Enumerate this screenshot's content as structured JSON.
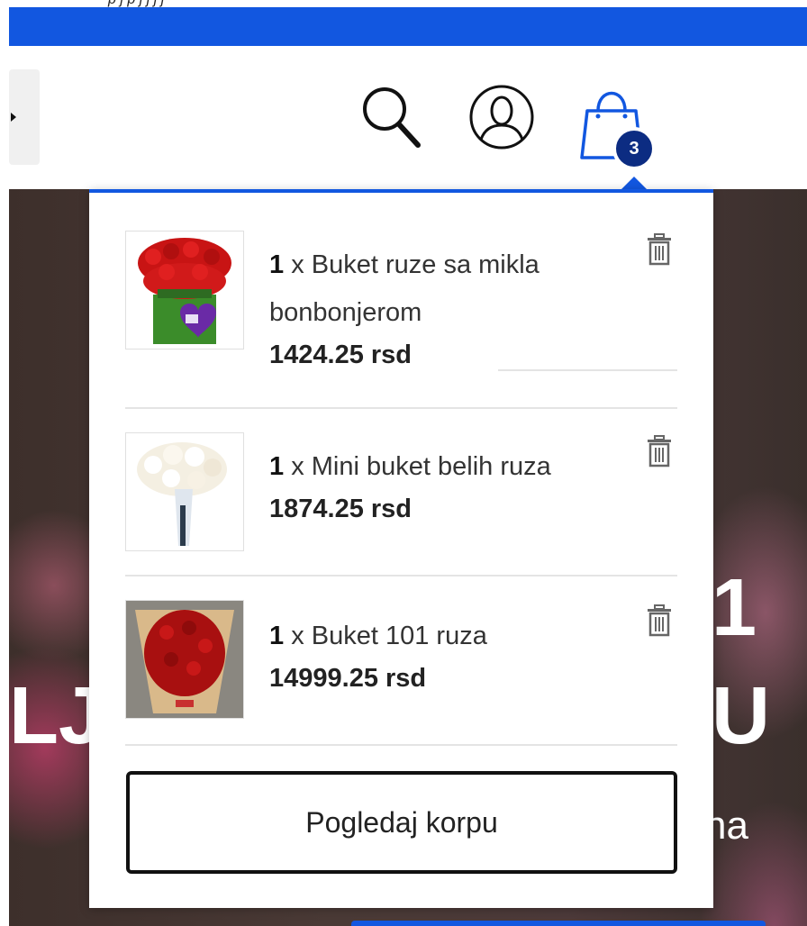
{
  "top_strip_text": "p                    j            p  j  j  j  j",
  "header": {
    "search_icon": "search-icon",
    "account_icon": "user-icon",
    "cart_icon": "shopping-bag-icon",
    "cart_count": "3"
  },
  "cart": {
    "items": [
      {
        "qty": "1",
        "separator": " x ",
        "name": "Buket ruze sa mikla bonbonjerom",
        "price": "1424.25 rsd"
      },
      {
        "qty": "1",
        "separator": " x ",
        "name": "Mini buket belih ruza",
        "price": "1874.25 rsd"
      },
      {
        "qty": "1",
        "separator": " x ",
        "name": "Buket 101 ruza",
        "price": "14999.25 rsd"
      }
    ],
    "view_cart_label": "Pogledaj korpu"
  },
  "hero": {
    "left_letters": "LJ",
    "right_letter_top": "1",
    "right_letter_mid": "U",
    "right_letters_bottom": "na"
  },
  "colors": {
    "accent_blue": "#1257e0",
    "badge_navy": "#0c2c82",
    "text_dark": "#222222"
  }
}
